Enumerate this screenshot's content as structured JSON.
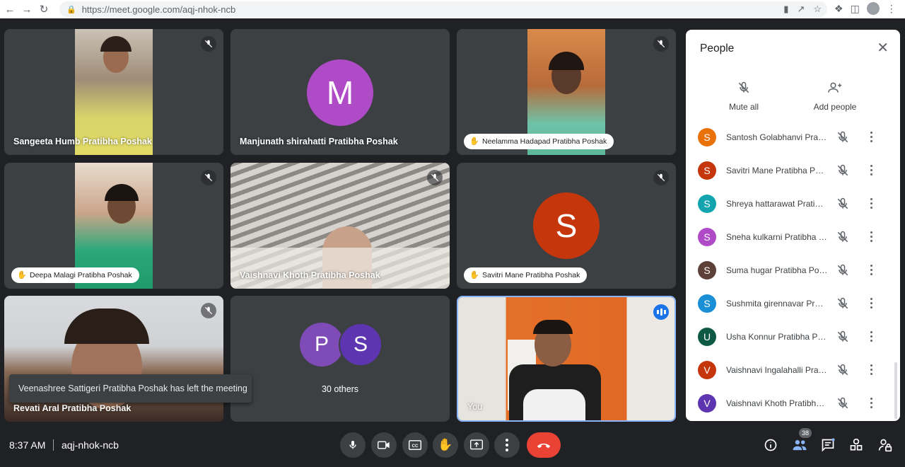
{
  "browser": {
    "url": "https://meet.google.com/aqj-nhok-ncb"
  },
  "tiles": [
    {
      "name": "Sangeeta Humb  Pratibha Poshak"
    },
    {
      "name": "Manjunath shirahatti Pratibha Poshak",
      "initial": "M",
      "avatar_color": "#b04bc8"
    },
    {
      "name": "Neelamma Hadapad Pratibha Poshak"
    },
    {
      "name": "Deepa Malagi Pratibha Poshak"
    },
    {
      "name": "Vaishnavi Khoth Pratibha Poshak"
    },
    {
      "name": "Savitri Mane Pratibha Poshak",
      "initial": "S",
      "avatar_color": "#c5360d"
    },
    {
      "name": "Revati Aral Pratibha Poshak"
    },
    {
      "name": "30 others",
      "initials": [
        "P",
        "S"
      ],
      "avatar_colors": [
        "#7f4bb7",
        "#5e35b1"
      ]
    },
    {
      "name": "You"
    }
  ],
  "toast": {
    "text": "Veenashree Sattigeri Pratibha Poshak has left the meeting"
  },
  "people_panel": {
    "title": "People",
    "mute_all": "Mute all",
    "add_people": "Add people",
    "participants": [
      {
        "initial": "S",
        "color": "#e8710a",
        "name": "Santosh Golabhanvi Pratibha Poshak"
      },
      {
        "initial": "S",
        "color": "#c5360d",
        "name": "Savitri Mane Pratibha Poshak"
      },
      {
        "initial": "S",
        "color": "#12a4af",
        "name": "Shreya hattarawat Pratibha Poshak"
      },
      {
        "initial": "S",
        "color": "#b04bc8",
        "name": "Sneha kulkarni Pratibha Poshak"
      },
      {
        "initial": "S",
        "color": "#5d4037",
        "name": "Suma hugar Pratibha Poshak"
      },
      {
        "initial": "S",
        "color": "#1a8fd6",
        "name": "Sushmita girennavar Pratibha Poshak"
      },
      {
        "initial": "U",
        "color": "#0d5944",
        "name": "Usha Konnur Pratibha Poshak"
      },
      {
        "initial": "V",
        "color": "#c5360d",
        "name": "Vaishnavi Ingalahalli Pratibha Poshak"
      },
      {
        "initial": "V",
        "color": "#5e35b1",
        "name": "Vaishnavi Khoth Pratibha Poshak"
      }
    ]
  },
  "bottom_bar": {
    "time": "8:37 AM",
    "meeting_code": "aqj-nhok-ncb",
    "participant_count": "38"
  }
}
